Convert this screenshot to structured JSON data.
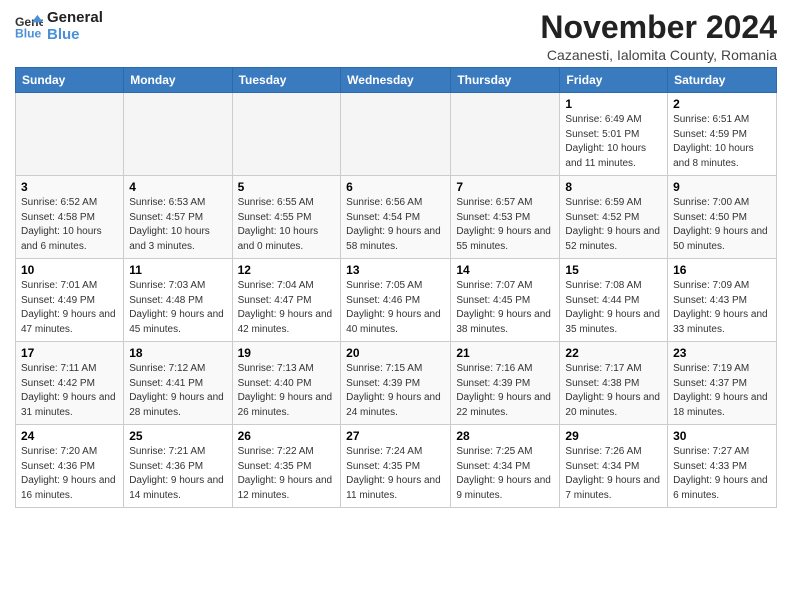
{
  "logo": {
    "line1": "General",
    "line2": "Blue"
  },
  "title": "November 2024",
  "subtitle": "Cazanesti, Ialomita County, Romania",
  "weekdays": [
    "Sunday",
    "Monday",
    "Tuesday",
    "Wednesday",
    "Thursday",
    "Friday",
    "Saturday"
  ],
  "weeks": [
    [
      {
        "day": "",
        "info": ""
      },
      {
        "day": "",
        "info": ""
      },
      {
        "day": "",
        "info": ""
      },
      {
        "day": "",
        "info": ""
      },
      {
        "day": "",
        "info": ""
      },
      {
        "day": "1",
        "info": "Sunrise: 6:49 AM\nSunset: 5:01 PM\nDaylight: 10 hours and 11 minutes."
      },
      {
        "day": "2",
        "info": "Sunrise: 6:51 AM\nSunset: 4:59 PM\nDaylight: 10 hours and 8 minutes."
      }
    ],
    [
      {
        "day": "3",
        "info": "Sunrise: 6:52 AM\nSunset: 4:58 PM\nDaylight: 10 hours and 6 minutes."
      },
      {
        "day": "4",
        "info": "Sunrise: 6:53 AM\nSunset: 4:57 PM\nDaylight: 10 hours and 3 minutes."
      },
      {
        "day": "5",
        "info": "Sunrise: 6:55 AM\nSunset: 4:55 PM\nDaylight: 10 hours and 0 minutes."
      },
      {
        "day": "6",
        "info": "Sunrise: 6:56 AM\nSunset: 4:54 PM\nDaylight: 9 hours and 58 minutes."
      },
      {
        "day": "7",
        "info": "Sunrise: 6:57 AM\nSunset: 4:53 PM\nDaylight: 9 hours and 55 minutes."
      },
      {
        "day": "8",
        "info": "Sunrise: 6:59 AM\nSunset: 4:52 PM\nDaylight: 9 hours and 52 minutes."
      },
      {
        "day": "9",
        "info": "Sunrise: 7:00 AM\nSunset: 4:50 PM\nDaylight: 9 hours and 50 minutes."
      }
    ],
    [
      {
        "day": "10",
        "info": "Sunrise: 7:01 AM\nSunset: 4:49 PM\nDaylight: 9 hours and 47 minutes."
      },
      {
        "day": "11",
        "info": "Sunrise: 7:03 AM\nSunset: 4:48 PM\nDaylight: 9 hours and 45 minutes."
      },
      {
        "day": "12",
        "info": "Sunrise: 7:04 AM\nSunset: 4:47 PM\nDaylight: 9 hours and 42 minutes."
      },
      {
        "day": "13",
        "info": "Sunrise: 7:05 AM\nSunset: 4:46 PM\nDaylight: 9 hours and 40 minutes."
      },
      {
        "day": "14",
        "info": "Sunrise: 7:07 AM\nSunset: 4:45 PM\nDaylight: 9 hours and 38 minutes."
      },
      {
        "day": "15",
        "info": "Sunrise: 7:08 AM\nSunset: 4:44 PM\nDaylight: 9 hours and 35 minutes."
      },
      {
        "day": "16",
        "info": "Sunrise: 7:09 AM\nSunset: 4:43 PM\nDaylight: 9 hours and 33 minutes."
      }
    ],
    [
      {
        "day": "17",
        "info": "Sunrise: 7:11 AM\nSunset: 4:42 PM\nDaylight: 9 hours and 31 minutes."
      },
      {
        "day": "18",
        "info": "Sunrise: 7:12 AM\nSunset: 4:41 PM\nDaylight: 9 hours and 28 minutes."
      },
      {
        "day": "19",
        "info": "Sunrise: 7:13 AM\nSunset: 4:40 PM\nDaylight: 9 hours and 26 minutes."
      },
      {
        "day": "20",
        "info": "Sunrise: 7:15 AM\nSunset: 4:39 PM\nDaylight: 9 hours and 24 minutes."
      },
      {
        "day": "21",
        "info": "Sunrise: 7:16 AM\nSunset: 4:39 PM\nDaylight: 9 hours and 22 minutes."
      },
      {
        "day": "22",
        "info": "Sunrise: 7:17 AM\nSunset: 4:38 PM\nDaylight: 9 hours and 20 minutes."
      },
      {
        "day": "23",
        "info": "Sunrise: 7:19 AM\nSunset: 4:37 PM\nDaylight: 9 hours and 18 minutes."
      }
    ],
    [
      {
        "day": "24",
        "info": "Sunrise: 7:20 AM\nSunset: 4:36 PM\nDaylight: 9 hours and 16 minutes."
      },
      {
        "day": "25",
        "info": "Sunrise: 7:21 AM\nSunset: 4:36 PM\nDaylight: 9 hours and 14 minutes."
      },
      {
        "day": "26",
        "info": "Sunrise: 7:22 AM\nSunset: 4:35 PM\nDaylight: 9 hours and 12 minutes."
      },
      {
        "day": "27",
        "info": "Sunrise: 7:24 AM\nSunset: 4:35 PM\nDaylight: 9 hours and 11 minutes."
      },
      {
        "day": "28",
        "info": "Sunrise: 7:25 AM\nSunset: 4:34 PM\nDaylight: 9 hours and 9 minutes."
      },
      {
        "day": "29",
        "info": "Sunrise: 7:26 AM\nSunset: 4:34 PM\nDaylight: 9 hours and 7 minutes."
      },
      {
        "day": "30",
        "info": "Sunrise: 7:27 AM\nSunset: 4:33 PM\nDaylight: 9 hours and 6 minutes."
      }
    ]
  ]
}
